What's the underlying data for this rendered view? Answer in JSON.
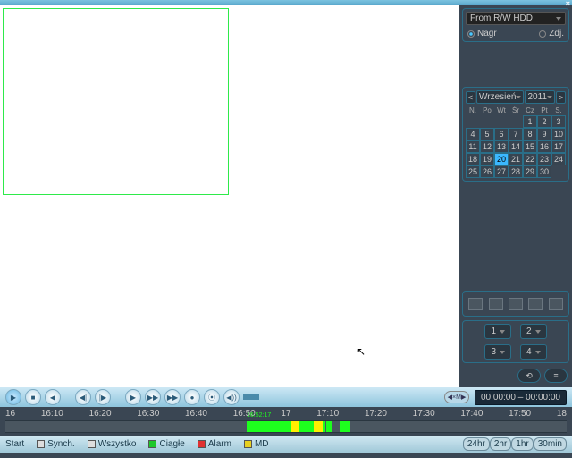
{
  "titlebar": {
    "close": "×"
  },
  "source": {
    "dropdown": "From R/W HDD",
    "opt1": "Nagr",
    "opt2": "Zdj."
  },
  "calendar": {
    "prev": "<",
    "next": ">",
    "month": "Wrzesień",
    "year": "2011",
    "dow": [
      "N.",
      "Po",
      "Wt",
      "Śr",
      "Cz",
      "Pt",
      "S."
    ],
    "days": [
      "",
      "",
      "",
      "",
      "1",
      "2",
      "3",
      "4",
      "5",
      "6",
      "7",
      "8",
      "9",
      "10",
      "11",
      "12",
      "13",
      "14",
      "15",
      "16",
      "17",
      "18",
      "19",
      "20",
      "21",
      "22",
      "23",
      "24",
      "25",
      "26",
      "27",
      "28",
      "29",
      "30"
    ],
    "selected": "20"
  },
  "channels": {
    "c1": "1",
    "c2": "2",
    "c3": "3",
    "c4": "4"
  },
  "bottombtns": {
    "b1": "⟲",
    "b2": "≡"
  },
  "transport": {
    "play": "▶",
    "stop": "■",
    "prev": "◀",
    "stepb": "◀|",
    "stepf": "|▶",
    "next": "▶",
    "ff": "▶▶",
    "ffwd": "▶▶",
    "rec": "●",
    "snap": "⦿",
    "vol": "◀))"
  },
  "timedisp": {
    "scrub": "◀×M▶",
    "t1": "00:00:00",
    "dash": " – ",
    "t2": "00:00:00"
  },
  "timeline": {
    "ticks": [
      "16",
      "16:10",
      "16:20",
      "16:30",
      "16:40",
      "16:50",
      "17",
      "17:10",
      "17:20",
      "17:30",
      "17:40",
      "17:50",
      "18"
    ],
    "cursor": "16:52:17"
  },
  "legend": {
    "start": "Start",
    "synch": "Synch.",
    "all": "Wszystko",
    "cont": "Ciągłe",
    "alarm": "Alarm",
    "md": "MD",
    "z24": "24hr",
    "z2": "2hr",
    "z1": "1hr",
    "z30": "30min"
  }
}
